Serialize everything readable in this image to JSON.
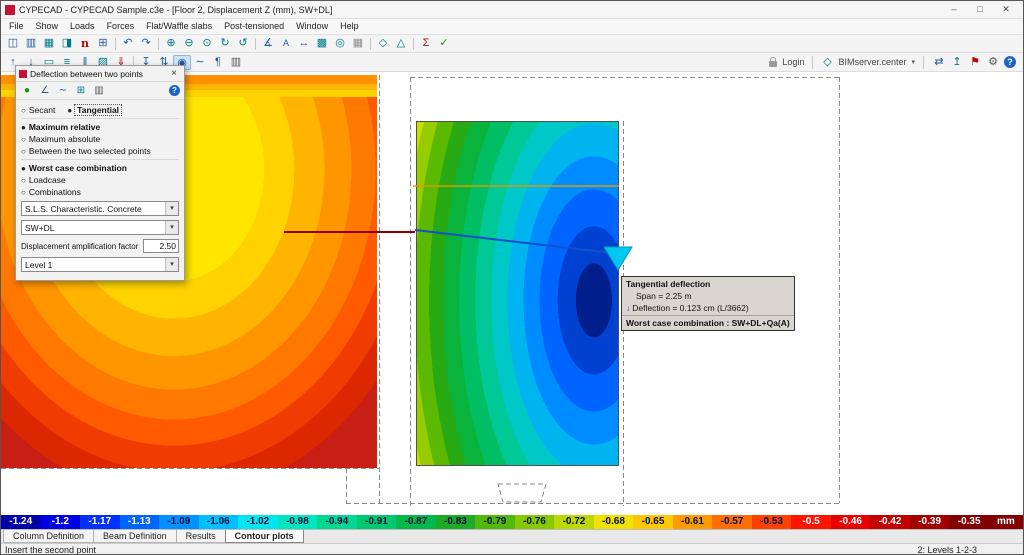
{
  "window": {
    "title": "CYPECAD - CYPECAD Sample.c3e - [Floor 2, Displacement Z (mm), SW+DL]",
    "minimize": "–",
    "maximize": "□",
    "close": "✕"
  },
  "menu": [
    "File",
    "Show",
    "Loads",
    "Forces",
    "Flat/Waffle slabs",
    "Post-tensioned",
    "Window",
    "Help"
  ],
  "toolbar1": [
    {
      "name": "save-icon",
      "glyph": "◫",
      "style": "color:#1e5aa0",
      "inter": "true"
    },
    {
      "name": "print-icon",
      "glyph": "▥",
      "style": "color:#1e5aa0",
      "inter": "true"
    },
    {
      "name": "job-data-icon",
      "glyph": "▦",
      "style": "color:#00788c",
      "inter": "true"
    },
    {
      "name": "general-data-icon",
      "glyph": "◨",
      "style": "color:#00788c",
      "inter": "true"
    },
    {
      "name": "cype-news-icon",
      "glyph": "n",
      "style": "color:#c00000;font-weight:bold;font-family:'DejaVu Serif',serif",
      "inter": "true"
    },
    {
      "name": "tables-icon",
      "glyph": "⊞",
      "style": "color:#1e5aa0",
      "inter": "true"
    },
    {
      "name": "separator",
      "glyph": "",
      "style": "width:1px;flex:0 0 1px;height:12px;background:#c4c4c4;margin:0 3px",
      "inter": "false"
    },
    {
      "name": "undo-icon",
      "glyph": "↶",
      "style": "color:#1e5aa0",
      "inter": "true"
    },
    {
      "name": "redo-icon",
      "glyph": "↷",
      "style": "color:#1e5aa0",
      "inter": "true"
    },
    {
      "name": "separator",
      "glyph": "",
      "style": "width:1px;flex:0 0 1px;height:12px;background:#c4c4c4;margin:0 3px",
      "inter": "false"
    },
    {
      "name": "zoom-in-icon",
      "glyph": "⊕",
      "style": "color:#00788c",
      "inter": "true"
    },
    {
      "name": "zoom-out-icon",
      "glyph": "⊖",
      "style": "color:#00788c",
      "inter": "true"
    },
    {
      "name": "zoom-window-icon",
      "glyph": "⊙",
      "style": "color:#00788c",
      "inter": "true"
    },
    {
      "name": "redraw-icon",
      "glyph": "↻",
      "style": "color:#00788c",
      "inter": "true"
    },
    {
      "name": "previous-zoom-icon",
      "glyph": "↺",
      "style": "color:#00788c",
      "inter": "true"
    },
    {
      "name": "separator",
      "glyph": "",
      "style": "width:1px;flex:0 0 1px;height:12px;background:#c4c4c4;margin:0 3px",
      "inter": "false"
    },
    {
      "name": "measure-icon",
      "glyph": "∡",
      "style": "color:#1e5aa0",
      "inter": "true"
    },
    {
      "name": "text-icon",
      "glyph": "A",
      "style": "color:#1e5aa0;font-size:9px",
      "inter": "true"
    },
    {
      "name": "dimension-icon",
      "glyph": "↔",
      "style": "color:#1e5aa0",
      "inter": "true"
    },
    {
      "name": "layers-icon",
      "glyph": "▩",
      "style": "color:#00788c",
      "inter": "true"
    },
    {
      "name": "object-snap-icon",
      "glyph": "◎",
      "style": "color:#00788c",
      "inter": "true"
    },
    {
      "name": "grid-icon",
      "glyph": "▦",
      "style": "color:#8c8c8c",
      "inter": "true"
    },
    {
      "name": "separator",
      "glyph": "",
      "style": "width:1px;flex:0 0 1px;height:12px;background:#c4c4c4;margin:0 3px",
      "inter": "false"
    },
    {
      "name": "views-icon",
      "glyph": "◇",
      "style": "color:#00788c",
      "inter": "true"
    },
    {
      "name": "3d-view-icon",
      "glyph": "△",
      "style": "color:#00788c",
      "inter": "true"
    },
    {
      "name": "separator",
      "glyph": "",
      "style": "width:1px;flex:0 0 1px;height:12px;background:#c4c4c4;margin:0 3px",
      "inter": "false"
    },
    {
      "name": "calculate-icon",
      "glyph": "Σ",
      "style": "color:#a01414",
      "inter": "true"
    },
    {
      "name": "check-icon",
      "glyph": "✓",
      "style": "color:#148c14",
      "inter": "true"
    }
  ],
  "toolbar2": {
    "left": [
      {
        "name": "go-up-floor-icon",
        "glyph": "↑",
        "style": "color:#1e5aa0",
        "inter": "true"
      },
      {
        "name": "go-down-floor-icon",
        "glyph": "↓",
        "style": "color:#1e5aa0",
        "inter": "true"
      },
      {
        "name": "floor-plan-icon",
        "glyph": "▭",
        "style": "color:#00788c",
        "inter": "true"
      },
      {
        "name": "beam-definition-icon",
        "glyph": "≡",
        "style": "color:#00788c",
        "inter": "true"
      },
      {
        "name": "column-definition-icon",
        "glyph": "‖",
        "style": "color:#1e5aa0",
        "inter": "true"
      },
      {
        "name": "slab-icon",
        "glyph": "▨",
        "style": "color:#00788c",
        "inter": "true"
      },
      {
        "name": "loads-icon",
        "glyph": "⇓",
        "style": "color:#a01414",
        "inter": "true"
      },
      {
        "name": "separator",
        "glyph": "",
        "style": "width:1px;flex:0 0 1px;height:12px;background:#c4c4c4;margin:0 3px",
        "inter": "false"
      },
      {
        "name": "displacement-icon",
        "glyph": "↧",
        "style": "color:#1e5aa0",
        "inter": "true"
      },
      {
        "name": "forces-icon",
        "glyph": "⇅",
        "style": "color:#1e5aa0",
        "inter": "true"
      },
      {
        "name": "contour-plots-icon",
        "glyph": "◉",
        "style": "color:#1e5aa0;background:#cde3f6;border:1px solid #86b4dc",
        "inter": "true"
      },
      {
        "name": "deflection-icon",
        "glyph": "∼",
        "style": "color:#00788c",
        "inter": "true"
      },
      {
        "name": "report-icon",
        "glyph": "¶",
        "style": "color:#1e5aa0",
        "inter": "true"
      },
      {
        "name": "print-plan-icon",
        "glyph": "▥",
        "style": "color:#555555",
        "inter": "true"
      }
    ],
    "login_label": "Login",
    "bim_glyph": "◇",
    "bim_label": "BIMserver.center",
    "dropdown_glyph": "▾",
    "right": [
      {
        "name": "bim-sync-icon",
        "glyph": "⇄",
        "style": "color:#1e5aa0",
        "inter": "true"
      },
      {
        "name": "bim-upload-icon",
        "glyph": "↥",
        "style": "color:#00788c",
        "inter": "true"
      },
      {
        "name": "bim-flag-icon",
        "glyph": "⚑",
        "style": "color:#c00000",
        "inter": "true"
      },
      {
        "name": "settings-icon",
        "glyph": "⚙",
        "style": "color:#555555",
        "inter": "true"
      },
      {
        "name": "help-icon",
        "glyph": "?",
        "style": "color:#ffffff;background:#1e64c8;border-radius:50%;width:12px;flex:0 0 12px;height:12px;line-height:12px;font-size:9px;font-weight:bold",
        "inter": "true"
      }
    ]
  },
  "dialog": {
    "title": "Deflection between two points",
    "close": "×",
    "icons": [
      {
        "name": "first-point-icon",
        "glyph": "●",
        "style": "color:#00a000",
        "inter": "true"
      },
      {
        "name": "secant-line-icon",
        "glyph": "∠",
        "style": "color:#1e5aa0",
        "inter": "true"
      },
      {
        "name": "tangent-line-icon",
        "glyph": "∼",
        "style": "color:#1e5aa0",
        "inter": "true"
      },
      {
        "name": "values-table-icon",
        "glyph": "⊞",
        "style": "color:#00788c",
        "inter": "true"
      },
      {
        "name": "print-view-icon",
        "glyph": "▥",
        "style": "color:#555555",
        "inter": "true"
      },
      {
        "name": "dialog-help-icon",
        "glyph": "?",
        "style": "color:#ffffff;background:#1e64c8;border-radius:50%;width:11px;flex:0 0 11px;height:11px;line-height:11px;font-size:8px;font-weight:bold;margin-left:auto",
        "inter": "true"
      }
    ],
    "type_options": [
      {
        "name": "radio-secant",
        "label": "Secant",
        "dot": "○",
        "style": ""
      },
      {
        "name": "radio-tangential",
        "label": "Tangential",
        "dot": "●",
        "style": "font-weight:bold;outline:1px dotted #555;padding:0 2px"
      }
    ],
    "mode_options": [
      {
        "name": "radio-maximum-relative",
        "label": "Maximum relative",
        "dot": "●",
        "style": "font-weight:bold"
      },
      {
        "name": "radio-maximum-absolute",
        "label": "Maximum absolute",
        "dot": "○",
        "style": ""
      },
      {
        "name": "radio-between-two-points",
        "label": "Between the two selected points",
        "dot": "○",
        "style": ""
      }
    ],
    "case_options": [
      {
        "name": "radio-worst-case",
        "label": "Worst case combination",
        "dot": "●",
        "style": "font-weight:bold"
      },
      {
        "name": "radio-loadcase",
        "label": "Loadcase",
        "dot": "○",
        "style": ""
      },
      {
        "name": "radio-combinations",
        "label": "Combinations",
        "dot": "○",
        "style": ""
      }
    ],
    "combo1": "S.L.S. Characteristic. Concrete",
    "combo2": "SW+DL",
    "combo_arrow": "▾",
    "amplification_label": "Displacement amplification factor",
    "amplification_value": "2.50",
    "combo3": "Level 1"
  },
  "tooltip": {
    "title": "Tangential deflection",
    "span": "Span = 2.25 m",
    "arrow": "↓",
    "deflection": "Deflection = 0.123 cm (L/3662)",
    "worst": "Worst case combination : SW+DL+Qa(A)"
  },
  "scale": {
    "entries": [
      {
        "value": "-1.24",
        "style": "background:#0000aa;color:#ffffff"
      },
      {
        "value": "-1.2",
        "style": "background:#0000e6;color:#ffffff"
      },
      {
        "value": "-1.17",
        "style": "background:#0032ff;color:#ffffff"
      },
      {
        "value": "-1.13",
        "style": "background:#0064ff;color:#ffffff"
      },
      {
        "value": "-1.09",
        "style": "background:#0091ff;color:#001040"
      },
      {
        "value": "-1.06",
        "style": "background:#00bfff;color:#001040"
      },
      {
        "value": "-1.02",
        "style": "background:#00e6f0;color:#001040"
      },
      {
        "value": "-0.98",
        "style": "background:#00e6c3;color:#001040"
      },
      {
        "value": "-0.94",
        "style": "background:#00d791;color:#001040"
      },
      {
        "value": "-0.91",
        "style": "background:#00c86e;color:#001040"
      },
      {
        "value": "-0.87",
        "style": "background:#00b94b;color:#001040"
      },
      {
        "value": "-0.83",
        "style": "background:#1eaa28;color:#001040"
      },
      {
        "value": "-0.79",
        "style": "background:#50b90a;color:#001040"
      },
      {
        "value": "-0.76",
        "style": "background:#87c800;color:#001040"
      },
      {
        "value": "-0.72",
        "style": "background:#bed700;color:#001040"
      },
      {
        "value": "-0.68",
        "style": "background:#f0e100;color:#001040"
      },
      {
        "value": "-0.65",
        "style": "background:#ffc800;color:#001040"
      },
      {
        "value": "-0.61",
        "style": "background:#ff9b00;color:#001040"
      },
      {
        "value": "-0.57",
        "style": "background:#ff6e00;color:#001040"
      },
      {
        "value": "-0.53",
        "style": "background:#ff4100;color:#001040"
      },
      {
        "value": "-0.5",
        "style": "background:#ff1400;color:#ffffff"
      },
      {
        "value": "-0.46",
        "style": "background:#e60000;color:#ffffff"
      },
      {
        "value": "-0.42",
        "style": "background:#c30000;color:#ffffff"
      },
      {
        "value": "-0.39",
        "style": "background:#a00000;color:#ffffff"
      },
      {
        "value": "-0.35",
        "style": "background:#820000;color:#ffffff"
      },
      {
        "value": "mm",
        "style": "background:#820000;color:#ffffff;flex:0 0 34px"
      }
    ]
  },
  "tabs": [
    {
      "label": "Column Definition",
      "style": ""
    },
    {
      "label": "Beam Definition",
      "style": ""
    },
    {
      "label": "Results",
      "style": ""
    },
    {
      "label": "Contour plots",
      "style": "background:#ffffff;border-color:#888888;font-weight:bold"
    }
  ],
  "status": {
    "left": "Insert the second point",
    "right": "2: Levels 1-2-3"
  }
}
